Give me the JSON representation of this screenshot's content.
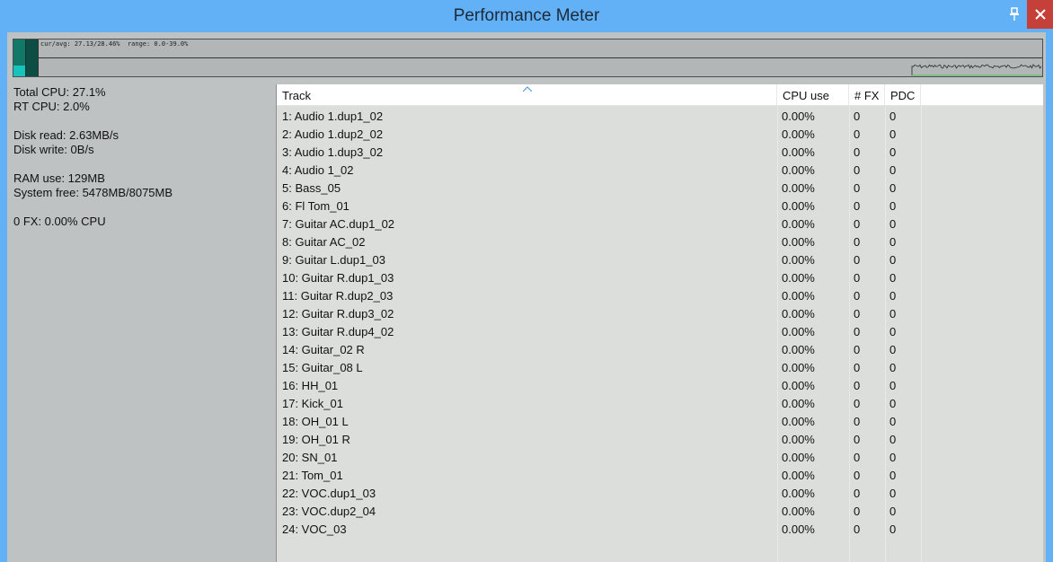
{
  "window": {
    "title": "Performance Meter"
  },
  "graph": {
    "label": "cur/avg: 27.13/28.46%  range: 0.0-39.0%"
  },
  "stats": {
    "total_cpu": "Total CPU: 27.1%",
    "rt_cpu": "RT CPU: 2.0%",
    "disk_read": "Disk read: 2.63MB/s",
    "disk_write": "Disk write: 0B/s",
    "ram_use": "RAM use: 129MB",
    "system_free": "System free: 5478MB/8075MB",
    "fx_cpu": "0 FX: 0.00% CPU"
  },
  "table": {
    "headers": {
      "track": "Track",
      "cpu": "CPU use",
      "fx": "# FX",
      "pdc": "PDC"
    },
    "rows": [
      {
        "track": "1: Audio 1.dup1_02",
        "cpu": "0.00%",
        "fx": "0",
        "pdc": "0"
      },
      {
        "track": "2: Audio 1.dup2_02",
        "cpu": "0.00%",
        "fx": "0",
        "pdc": "0"
      },
      {
        "track": "3: Audio 1.dup3_02",
        "cpu": "0.00%",
        "fx": "0",
        "pdc": "0"
      },
      {
        "track": "4: Audio 1_02",
        "cpu": "0.00%",
        "fx": "0",
        "pdc": "0"
      },
      {
        "track": "5: Bass_05",
        "cpu": "0.00%",
        "fx": "0",
        "pdc": "0"
      },
      {
        "track": "6: Fl Tom_01",
        "cpu": "0.00%",
        "fx": "0",
        "pdc": "0"
      },
      {
        "track": "7: Guitar AC.dup1_02",
        "cpu": "0.00%",
        "fx": "0",
        "pdc": "0"
      },
      {
        "track": "8: Guitar AC_02",
        "cpu": "0.00%",
        "fx": "0",
        "pdc": "0"
      },
      {
        "track": "9: Guitar L.dup1_03",
        "cpu": "0.00%",
        "fx": "0",
        "pdc": "0"
      },
      {
        "track": "10: Guitar R.dup1_03",
        "cpu": "0.00%",
        "fx": "0",
        "pdc": "0"
      },
      {
        "track": "11: Guitar R.dup2_03",
        "cpu": "0.00%",
        "fx": "0",
        "pdc": "0"
      },
      {
        "track": "12: Guitar R.dup3_02",
        "cpu": "0.00%",
        "fx": "0",
        "pdc": "0"
      },
      {
        "track": "13: Guitar R.dup4_02",
        "cpu": "0.00%",
        "fx": "0",
        "pdc": "0"
      },
      {
        "track": "14: Guitar_02 R",
        "cpu": "0.00%",
        "fx": "0",
        "pdc": "0"
      },
      {
        "track": "15: Guitar_08 L",
        "cpu": "0.00%",
        "fx": "0",
        "pdc": "0"
      },
      {
        "track": "16: HH_01",
        "cpu": "0.00%",
        "fx": "0",
        "pdc": "0"
      },
      {
        "track": "17: Kick_01",
        "cpu": "0.00%",
        "fx": "0",
        "pdc": "0"
      },
      {
        "track": "18: OH_01 L",
        "cpu": "0.00%",
        "fx": "0",
        "pdc": "0"
      },
      {
        "track": "19: OH_01 R",
        "cpu": "0.00%",
        "fx": "0",
        "pdc": "0"
      },
      {
        "track": "20: SN_01",
        "cpu": "0.00%",
        "fx": "0",
        "pdc": "0"
      },
      {
        "track": "21: Tom_01",
        "cpu": "0.00%",
        "fx": "0",
        "pdc": "0"
      },
      {
        "track": "22: VOC.dup1_03",
        "cpu": "0.00%",
        "fx": "0",
        "pdc": "0"
      },
      {
        "track": "23: VOC.dup2_04",
        "cpu": "0.00%",
        "fx": "0",
        "pdc": "0"
      },
      {
        "track": "24: VOC_03",
        "cpu": "0.00%",
        "fx": "0",
        "pdc": "0"
      }
    ]
  },
  "icons": {
    "pin": "pin-icon",
    "close": "close-icon",
    "sort": "sort-ascending-icon"
  },
  "colors": {
    "titlebar": "#62b0f5",
    "close": "#c6403a",
    "cpu_bar": "#16c4bb",
    "graph_trace": "#4ec24a"
  }
}
